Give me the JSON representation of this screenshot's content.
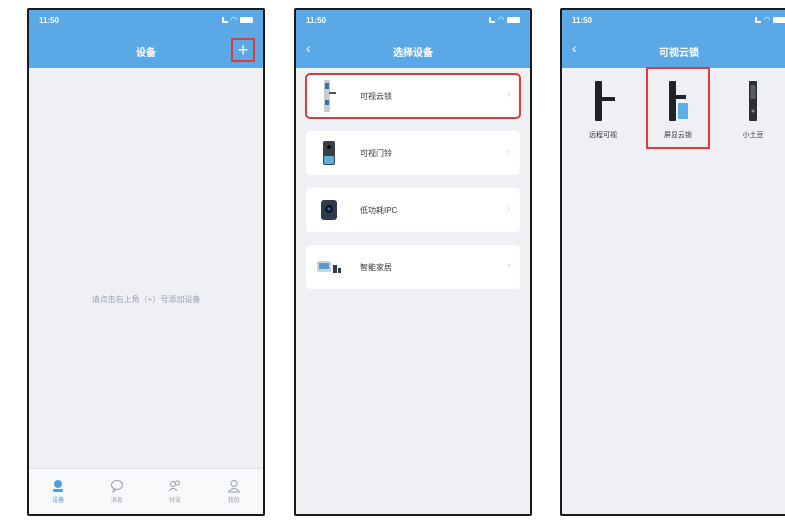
{
  "screen1": {
    "status": {
      "time": "11:50"
    },
    "title": "设备",
    "add_icon": "plus-icon",
    "empty_message": "请点击右上角（+）号添加设备",
    "tabs": [
      {
        "label": "设备",
        "icon": "device-icon",
        "active": true
      },
      {
        "label": "消息",
        "icon": "message-icon",
        "active": false
      },
      {
        "label": "好友",
        "icon": "friends-icon",
        "active": false
      },
      {
        "label": "我的",
        "icon": "profile-icon",
        "active": false
      }
    ]
  },
  "screen2": {
    "status": {
      "time": "11:50"
    },
    "title": "选择设备",
    "items": [
      {
        "label": "可视云锁",
        "icon": "smart-lock-icon",
        "selected": true
      },
      {
        "label": "可视门铃",
        "icon": "doorbell-icon",
        "selected": false
      },
      {
        "label": "低功耗IPC",
        "icon": "camera-icon",
        "selected": false
      },
      {
        "label": "智能家居",
        "icon": "smart-home-icon",
        "selected": false
      }
    ]
  },
  "screen3": {
    "status": {
      "time": "11:50"
    },
    "title": "可视云锁",
    "locks": [
      {
        "label": "远程可视",
        "selected": false
      },
      {
        "label": "屏显云锁",
        "selected": true
      },
      {
        "label": "小土豆",
        "selected": false
      }
    ]
  },
  "colors": {
    "header_bg": "#5aa9e6",
    "highlight": "#e03a3a",
    "page_bg": "#eef0f4",
    "active_tab": "#4a9fe0"
  }
}
